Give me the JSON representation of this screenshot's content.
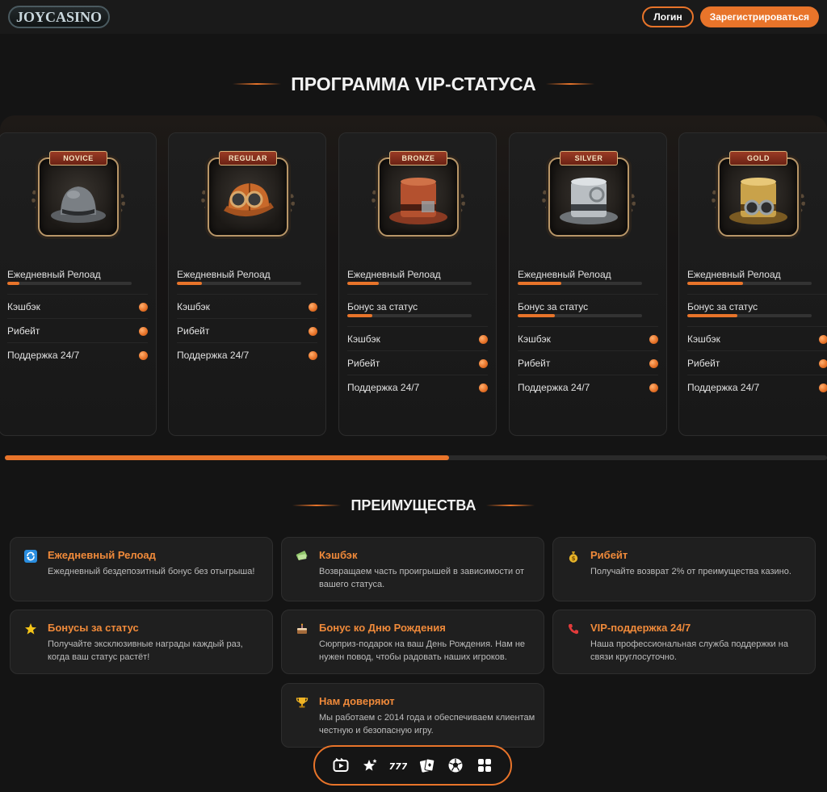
{
  "header": {
    "logo_text": "JOYCASINO",
    "login_label": "Логин",
    "register_label": "Зарегистрироваться"
  },
  "vip": {
    "title": "ПРОГРАММА VIP-СТАТУСА",
    "cards": [
      {
        "badge": "NOVICE",
        "hat_icon": "bowler-hat-icon",
        "rows": [
          {
            "label": "Ежедневный Релоад",
            "progress": 0.1
          },
          {
            "label": "Кэшбэк"
          },
          {
            "label": "Рибейт"
          },
          {
            "label": "Поддержка 24/7"
          }
        ]
      },
      {
        "badge": "REGULAR",
        "hat_icon": "deerstalker-hat-icon",
        "rows": [
          {
            "label": "Ежедневный Релоад",
            "progress": 0.2
          },
          {
            "label": "Кэшбэк"
          },
          {
            "label": "Рибейт"
          },
          {
            "label": "Поддержка 24/7"
          }
        ]
      },
      {
        "badge": "BRONZE",
        "hat_icon": "bronze-top-hat-icon",
        "rows": [
          {
            "label": "Ежедневный Релоад",
            "progress": 0.25
          },
          {
            "label": "Бонус за статус",
            "progress": 0.2
          },
          {
            "label": "Кэшбэк"
          },
          {
            "label": "Рибейт"
          },
          {
            "label": "Поддержка 24/7"
          }
        ]
      },
      {
        "badge": "SILVER",
        "hat_icon": "silver-top-hat-icon",
        "rows": [
          {
            "label": "Ежедневный Релоад",
            "progress": 0.35
          },
          {
            "label": "Бонус за статус",
            "progress": 0.3
          },
          {
            "label": "Кэшбэк"
          },
          {
            "label": "Рибейт"
          },
          {
            "label": "Поддержка 24/7"
          }
        ]
      },
      {
        "badge": "GOLD",
        "hat_icon": "gold-top-hat-icon",
        "rows": [
          {
            "label": "Ежедневный Релоад",
            "progress": 0.45
          },
          {
            "label": "Бонус за статус",
            "progress": 0.4
          },
          {
            "label": "Кэшбэк"
          },
          {
            "label": "Рибейт"
          },
          {
            "label": "Поддержка 24/7"
          }
        ]
      }
    ],
    "scroll_progress": 0.54
  },
  "advantages": {
    "title": "ПРЕИМУЩЕСТВА",
    "items": [
      {
        "icon": "reload-icon",
        "title": "Ежедневный Релоад",
        "desc": "Ежедневный бездепозитный бонус без отыгрыша!"
      },
      {
        "icon": "cashback-icon",
        "title": "Кэшбэк",
        "desc": "Возвращаем часть проигрышей в зависимости от вашего статуса."
      },
      {
        "icon": "money-bag-icon",
        "title": "Рибейт",
        "desc": "Получайте возврат 2% от преимущества казино."
      },
      {
        "icon": "star-icon",
        "title": "Бонусы за статус",
        "desc": "Получайте эксклюзивные награды каждый раз, когда ваш статус растёт!"
      },
      {
        "icon": "cake-icon",
        "title": "Бонус ко Дню Рождения",
        "desc": "Сюрприз-подарок на ваш День Рождения. Нам не нужен повод, чтобы радовать наших игроков."
      },
      {
        "icon": "phone-icon",
        "title": "VIP-поддержка 24/7",
        "desc": "Наша профессиональная служба поддержки на связи круглосуточно."
      },
      {
        "icon": "trophy-icon",
        "title": "Нам доверяют",
        "desc": "Мы работаем с 2014 года и обеспечиваем клиентам честную и безопасную игру."
      }
    ]
  },
  "bottom_nav": [
    "live-video-icon",
    "favorites-stars-icon",
    "slots-777-icon",
    "cards-icon",
    "sports-ball-icon",
    "grid-menu-icon"
  ],
  "colors": {
    "accent": "#e8742a",
    "background": "#141414",
    "card": "#1f1f1f"
  }
}
